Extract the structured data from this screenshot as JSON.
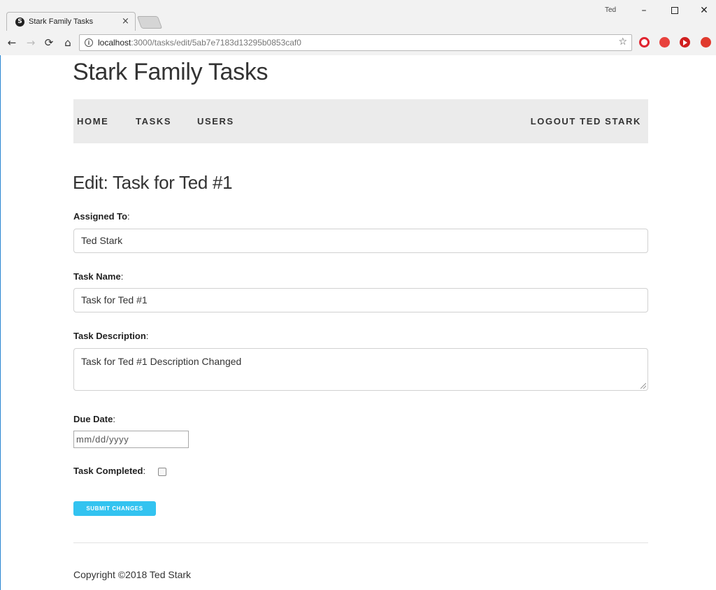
{
  "browser": {
    "tab_favicon_letter": "S",
    "tab_title": "Stark Family Tasks",
    "tab_close": "×",
    "profile_name": "Ted",
    "window": {
      "minimize": "–",
      "close": "✕"
    },
    "nav": {
      "back": "←",
      "forward": "→",
      "reload": "⟳",
      "home": "⌂"
    },
    "url_host": "localhost",
    "url_path": ":3000/tasks/edit/5ab7e7183d13295b0853caf0",
    "bookmark_star": "☆",
    "extensions": [
      "opera-icon",
      "ext-red-icon",
      "youtube-play-icon",
      "ext-up-arrow-icon"
    ]
  },
  "site": {
    "title": "Stark Family Tasks",
    "nav": {
      "home": "HOME",
      "tasks": "TASKS",
      "users": "USERS",
      "logout": "LOGOUT TED STARK"
    }
  },
  "form": {
    "heading": "Edit: Task for Ted #1",
    "assigned_to_label": "Assigned To",
    "assigned_to_value": "Ted Stark",
    "task_name_label": "Task Name",
    "task_name_value": "Task for Ted #1",
    "task_description_label": "Task Description",
    "task_description_value": "Task for Ted #1 Description Changed",
    "due_date_label": "Due Date",
    "due_date_placeholder": "mm/dd/yyyy",
    "task_completed_label": "Task Completed",
    "task_completed_checked": false,
    "submit_label": "SUBMIT CHANGES",
    "colon": ":"
  },
  "footer": {
    "copyright": "Copyright ©2018 Ted Stark"
  },
  "colors": {
    "accent": "#33c3f0",
    "navbar_bg": "#ebebeb"
  }
}
